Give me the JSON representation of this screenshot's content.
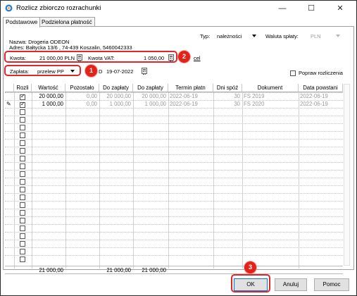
{
  "window": {
    "title": "Rozlicz zbiorczo rozrachunki",
    "minimize": "—",
    "maximize": "☐",
    "close": "✕"
  },
  "tabs": [
    {
      "label": "Podstawowe",
      "active": true
    },
    {
      "label": "Podzielona płatność",
      "active": false
    }
  ],
  "header": {
    "nazwa": "Nazwa: Drogeria ODEON",
    "adres": "Adres: Bałtycka  13/6 , 74-439 Koszalin, 5460042333",
    "typ_label": "Typ:",
    "typ_value": "należności",
    "waluta_label": "Waluta spłaty:",
    "waluta_value": "PLN"
  },
  "amounts": {
    "kwota_label": "Kwota:",
    "kwota_value": "21 000,00 PLN",
    "vat_label": "Kwota VAT:",
    "vat_value": "1 050,00",
    "extra_link": "cel"
  },
  "payment": {
    "zaplata_label": "Zapłata:",
    "zaplata_value": "przelew PP",
    "date_label": "D",
    "date_value": "19-07-2022",
    "popraw_label": "Popraw rozliczenia",
    "popraw_checked": false
  },
  "annotations": {
    "badge1": "1",
    "badge2": "2",
    "badge3": "3",
    "color": "#e2231a"
  },
  "table": {
    "columns": [
      "",
      "Rozli",
      "Wartość",
      "Pozostało",
      "Do zapłaty",
      "Do zapłaty",
      "Termin płatn",
      "Dni spóź",
      "Dokument",
      "Data powstani"
    ],
    "rows": [
      {
        "edit_marker": "",
        "checked": true,
        "wartosc": "20 000,00",
        "pozostalo": "0,00",
        "do_zaplaty1": "20 000,00",
        "do_zaplaty2": "20 000,00",
        "termin": "2022-06-19",
        "dni": "30",
        "dokument": "FS 2019",
        "data": "2022-06-19"
      },
      {
        "edit_marker": "✎",
        "checked": true,
        "wartosc": "1 000,00",
        "pozostalo": "0,00",
        "do_zaplaty1": "1 000,00",
        "do_zaplaty2": "1 000,00",
        "termin": "2022-06-19",
        "dni": "30",
        "dokument": "FS 2020",
        "data": "2022-06-19"
      }
    ],
    "empty_rows": 20,
    "totals": {
      "wartosc": "21 000,00",
      "do_zaplaty1": "21 000,00",
      "do_zaplaty2": "21 000,00"
    }
  },
  "buttons": {
    "ok": "OK",
    "anuluj": "Anuluj",
    "pomoc": "Pomoc"
  }
}
